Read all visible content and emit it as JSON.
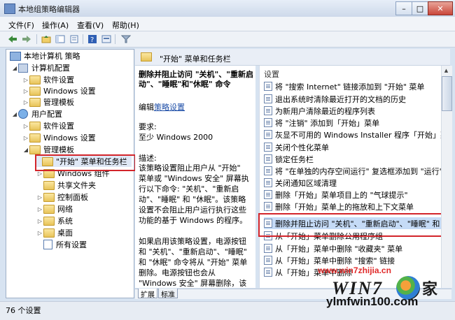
{
  "window": {
    "title": "本地组策略编辑器",
    "buttons": {
      "minimize": "–",
      "maximize": "□",
      "close": "✕"
    }
  },
  "menu": [
    "文件(F)",
    "操作(A)",
    "查看(V)",
    "帮助(H)"
  ],
  "toolbar": {
    "icons": [
      "back-arrow-icon",
      "forward-arrow-icon",
      "up-folder-icon",
      "show-hide-tree-icon",
      "export-list-icon",
      "help-icon",
      "properties-icon",
      "filter-icon"
    ]
  },
  "tree": {
    "root": "本地计算机 策略",
    "computer": "计算机配置",
    "computer_children": [
      "软件设置",
      "Windows 设置",
      "管理模板"
    ],
    "user": "用户配置",
    "user_children": [
      "软件设置",
      "Windows 设置",
      "管理模板"
    ],
    "admin_children": [
      "\"开始\" 菜单和任务栏",
      "Windows 组件",
      "共享文件夹",
      "控制面板",
      "网络",
      "系统",
      "桌面",
      "所有设置"
    ]
  },
  "content": {
    "header": "\"开始\" 菜单和任务栏",
    "policy_title": "删除并阻止访问 \"关机\"、\"重新启动\"、\"睡眠\"和\"休眠\" 命令",
    "edit_prefix": "编辑",
    "edit_link": "策略设置",
    "req_label": "要求:",
    "req_value": "至少 Windows 2000",
    "desc_label": "描述:",
    "desc_text": "该策略设置阻止用户从 \"开始\" 菜单或 \"Windows 安全\" 屏幕执行以下命令: \"关机\"、\"重新启动\"、\"睡眠\" 和 \"休眠\"。该策略设置不会阻止用户运行执行这些功能的基于 Windows 的程序。",
    "desc_text2": "如果启用该策略设置，电源按钮和 \"关机\"、\"重新启动\"、\"睡眠\" 和 \"休眠\" 命令将从 \"开始\" 菜单删除。电源按钮也会从 \"Windows 安全\" 屏幕删除，该屏幕在按 CTRL+ALT+DELETE 时",
    "list_header": "设置",
    "items": [
      "将 \"搜索 Internet\" 链接添加到 \"开始\" 菜单",
      "退出系统时清除最近打开的文档的历史",
      "为新用户清除最近的程序列表",
      "将 \"注销\" 添加到「开始」菜单",
      "灰显不可用的 Windows Installer 程序「开始」菜单快",
      "关闭个性化菜单",
      "锁定任务栏",
      "将 \"在单独的内存空间运行\" 复选框添加到 \"运行\" 对",
      "关闭通知区域清理",
      "删除「开始」菜单项目上的 \"气球提示\"",
      "删除「开始」菜单上的拖放和上下文菜单",
      "删除并阻止访问 \"关机\"、\"重新启动\"、\"睡眠\" 和",
      "从「开始」菜单删除公用程序组",
      "从「开始」菜单中删除 \"收藏夹\" 菜单",
      "从「开始」菜单中删除 \"搜索\" 链接",
      "从「开始」菜单中删除"
    ],
    "selected_index": 11
  },
  "tabs": [
    "扩展",
    "标准"
  ],
  "status": "76 个设置",
  "watermark": {
    "url": "www.win7zhijia.cn",
    "logo": "WIN7",
    "logo_suffix": "家",
    "bottom": "ylmfwin100.com"
  },
  "colors": {
    "highlight_border": "#d3252b",
    "selection": "#c5dbf6",
    "link": "#1f4fa8"
  }
}
